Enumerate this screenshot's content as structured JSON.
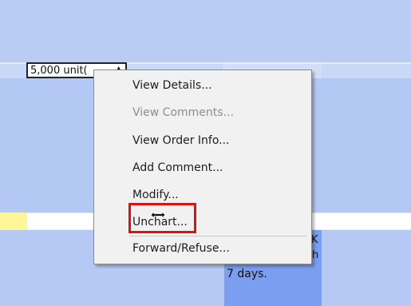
{
  "timeline": {
    "unit_label": "5,000 unit(",
    "unit_dropdown_symbol": "▲",
    "bar_partial_text": "K",
    "bar_partial_text2": "h",
    "duration_label": "7 days."
  },
  "context_menu": {
    "items": [
      {
        "label": "View Details...",
        "enabled": true
      },
      {
        "label": "View Comments...",
        "enabled": false
      },
      {
        "label": "View Order Info...",
        "enabled": true
      },
      {
        "label": "Add Comment...",
        "enabled": true
      },
      {
        "label": "Modify...",
        "enabled": true
      },
      {
        "label": "Unchart...",
        "enabled": true,
        "highlighted": true
      },
      {
        "label": "Forward/Refuse...",
        "enabled": true
      }
    ]
  },
  "colors": {
    "highlight": "#e01010",
    "chart_bar": "#7b9ef0",
    "background_band": "#b4c8f4",
    "marker": "#fff69a"
  },
  "icons": {
    "cursor": "move-cursor-icon"
  }
}
